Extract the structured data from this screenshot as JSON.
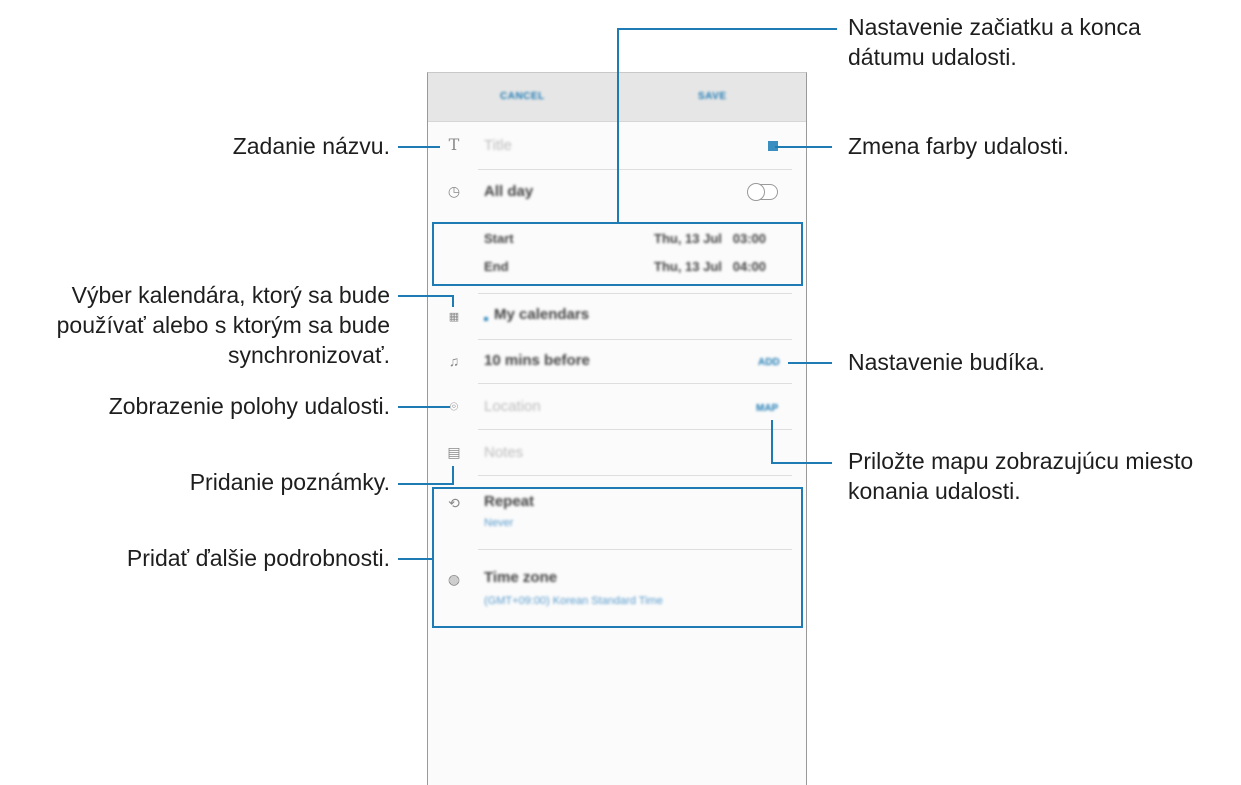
{
  "phone": {
    "topbar": {
      "cancel": "CANCEL",
      "save": "SAVE"
    },
    "title_placeholder": "Title",
    "all_day": "All day",
    "start_label": "Start",
    "start_value": "Thu, 13 Jul   03:00",
    "end_label": "End",
    "end_value": "Thu, 13 Jul   04:00",
    "calendar": "My calendars",
    "alarm": "10 mins before",
    "alarm_action": "ADD",
    "location_placeholder": "Location",
    "map_action": "MAP",
    "notes_placeholder": "Notes",
    "repeat_label": "Repeat",
    "repeat_value": "Never",
    "timezone_label": "Time zone",
    "timezone_value": "(GMT+09:00) Korean Standard Time"
  },
  "callouts": {
    "date_range": "Nastavenie začiatku a konca\ndátumu udalosti.",
    "title": "Zadanie názvu.",
    "color": "Zmena farby udalosti.",
    "calendar": "Výber kalendára, ktorý sa bude\npoužívať alebo s ktorým sa bude\nsynchronizovať.",
    "alarm": "Nastavenie budíka.",
    "location": "Zobrazenie polohy udalosti.",
    "map": "Priložte mapu zobrazujúcu miesto\nkonania udalosti.",
    "notes": "Pridanie poznámky.",
    "details": "Pridať ďalšie podrobnosti."
  },
  "colors": {
    "accent": "#1f7bb4",
    "event_color": "#3b8fc0"
  }
}
